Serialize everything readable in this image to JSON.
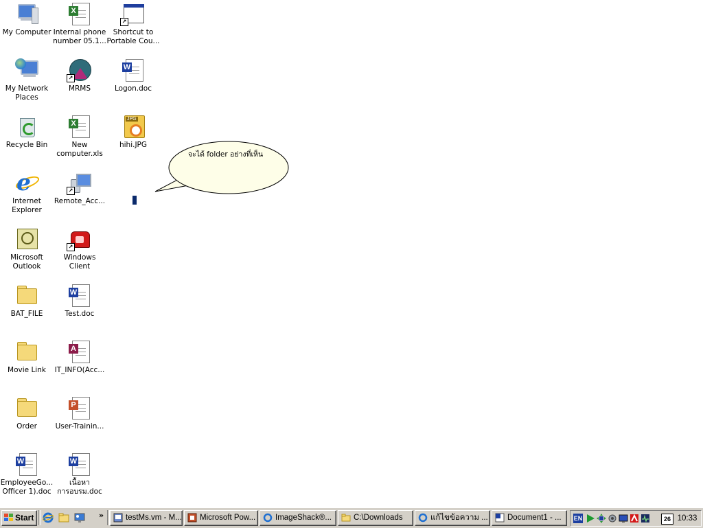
{
  "desktop": {
    "callout_text": "จะได้ folder อย่างที่เห็น",
    "icons": {
      "my_computer": "My Computer",
      "internal_phone": "Internal phone\nnumber 05.1...",
      "shortcut_portable": "Shortcut to\nPortable Cou...",
      "my_network_places": "My Network\nPlaces",
      "mrms": "MRMS",
      "logon_doc": "Logon.doc",
      "recycle_bin": "Recycle Bin",
      "new_computer_xls": "New\ncomputer.xls",
      "hihi_jpg": "hihi.JPG",
      "internet_explorer": "Internet\nExplorer",
      "remote_access": "Remote_Acc...",
      "microsoft_outlook": "Microsoft\nOutlook",
      "windows_client": "Windows Client",
      "bat_file": "BAT_FILE",
      "test_doc": "Test.doc",
      "movie_link": "Movie Link",
      "it_info": "IT_INFO(Acc...",
      "order": "Order",
      "user_training": "User-Trainin...",
      "employee_doc": "EmployeeGo...\nOfficer 1).doc",
      "content_doc": "เนื้อหา\nการอบรม.doc"
    }
  },
  "taskbar": {
    "start_label": "Start",
    "chevron": "»",
    "tasks": [
      {
        "label": "testMs.vm - M...",
        "icon": "vm-icon"
      },
      {
        "label": "Microsoft Pow...",
        "icon": "powerpoint-icon"
      },
      {
        "label": "ImageShack®...",
        "icon": "browser-icon"
      },
      {
        "label": "C:\\Downloads",
        "icon": "folder-icon"
      },
      {
        "label": "แก้ไขข้อความ ...",
        "icon": "browser-icon"
      },
      {
        "label": "Document1 - ...",
        "icon": "word-icon"
      }
    ]
  },
  "tray": {
    "language": "EN",
    "date_day": "26",
    "clock": "10:33"
  },
  "colors": {
    "desktop_bg": "#ffffff",
    "taskbar_bg": "#d4d0c8",
    "callout_fill": "#fefee8"
  }
}
